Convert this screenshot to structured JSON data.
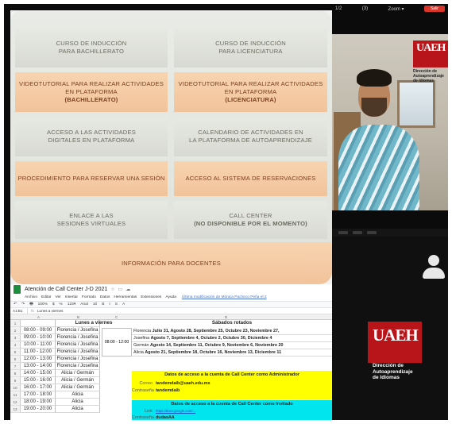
{
  "menu": {
    "tiles": [
      {
        "lines": [
          "Curso de inducción",
          "para Bachillerato"
        ],
        "style": "grey"
      },
      {
        "lines": [
          "Curso de inducción",
          "para Licenciatura"
        ],
        "style": "grey"
      },
      {
        "lines": [
          "Videotutorial para realizar actividades en plataforma"
        ],
        "strong": "(Bachillerato)",
        "style": "peach"
      },
      {
        "lines": [
          "Videotutorial para realizar actividades en plataforma"
        ],
        "strong": "(Licenciatura)",
        "style": "peach"
      },
      {
        "lines": [
          "Acceso a las actividades",
          "digitales en plataforma"
        ],
        "style": "grey"
      },
      {
        "lines": [
          "Calendario de actividades en",
          "la plataforma de autoaprendizaje"
        ],
        "style": "grey"
      },
      {
        "lines": [
          "Procedimiento para reservar una sesión"
        ],
        "style": "peach"
      },
      {
        "lines": [
          "Acceso al Sistema de Reservaciones"
        ],
        "style": "peach"
      },
      {
        "lines": [
          "Enlace a las",
          "Sesiones Virtuales"
        ],
        "style": "grey"
      },
      {
        "lines": [
          "Call Center"
        ],
        "strong": "(NO DISPONIBLE POR EL MOMENTO)",
        "style": "grey"
      },
      {
        "lines": [
          "Información para docentes"
        ],
        "style": "peach"
      }
    ]
  },
  "sheet": {
    "title": "Atención de Call Center J-D 2021",
    "menu": [
      "Archivo",
      "Editar",
      "Ver",
      "Insertar",
      "Formato",
      "Datos",
      "Herramientas",
      "Extensiones",
      "Ayuda"
    ],
    "last_edit": "Última modificación de Mónica Pacheco Peña el 2",
    "toolbar": [
      "↶",
      "↷",
      "🖶",
      "100%",
      "$",
      "%",
      "123▾",
      "Arial",
      "10",
      "B",
      "I",
      "S",
      "A"
    ],
    "cell_ref": "A1:B1",
    "formula": "Lunes a viernes",
    "col_letters": [
      "A",
      "B",
      "C",
      "D"
    ],
    "weekday_header": "Lunes a viernes",
    "saturday_header": "Sábados rotados",
    "rows": [
      {
        "n": "1",
        "time": "",
        "who": ""
      },
      {
        "n": "2",
        "time": "08:00 - 09:00",
        "who": "Florencia / Josefina"
      },
      {
        "n": "3",
        "time": "09:00 - 10:00",
        "who": "Florencia / Josefina"
      },
      {
        "n": "4",
        "time": "10:00 - 11:00",
        "who": "Florencia / Josefina"
      },
      {
        "n": "5",
        "time": "11:00 - 12:00",
        "who": "Florencia / Josefina"
      },
      {
        "n": "6",
        "time": "12:00 - 13:00",
        "who": "Florencia / Josefina"
      },
      {
        "n": "7",
        "time": "13:00 - 14:00",
        "who": "Florencia / Josefina"
      },
      {
        "n": "8",
        "time": "14:00 - 15:00",
        "who": "Alicia / Germán"
      },
      {
        "n": "9",
        "time": "15:00 - 16:00",
        "who": "Alicia / Germán"
      },
      {
        "n": "10",
        "time": "16:00 - 17:00",
        "who": "Alicia / Germán"
      },
      {
        "n": "11",
        "time": "17:00 - 18:00",
        "who": "Alicia"
      },
      {
        "n": "12",
        "time": "18:00 - 19:00",
        "who": "Alicia"
      },
      {
        "n": "13",
        "time": "19:00 - 20:00",
        "who": "Alicia"
      }
    ],
    "saturday_time": "08:00 - 12:00",
    "saturday_rows": [
      {
        "name": "Florencia",
        "dates": "Julio 31, Agosto 28, Septiembre 25, Octubre 23, Noviembre 27,"
      },
      {
        "name": "Josefina",
        "dates": "Agosto 7, Septiembre 4, Octubre 2, Octubre 30, Diciembre 4"
      },
      {
        "name": "Germán",
        "dates": "Agosto 14, Septiembre 11, Octubre 9, Noviembre 6, Noviembre 20"
      },
      {
        "name": "Alicia",
        "dates": "Agosto 21, Septiembre 18, Octubre 16, Noviembre 13, Diciembre 11"
      }
    ],
    "admin_box": {
      "title": "Datos de acceso a la cuenta de Call Center como Administrador",
      "email_label": "Correo",
      "email": "tandemdaib@uaeh.edu.mx",
      "password_label": "Contraseña",
      "password": "tandemdaib"
    },
    "guest_box": {
      "title": "Datos de acceso a la cuenta de Call Center como Invitado",
      "link_label": "Link",
      "link": "https://docs.google.com/...",
      "password_label": "Contraseña",
      "password": "dudasAA"
    }
  },
  "call": {
    "top_labels": [
      "1/2",
      "(3)",
      "Zoom ▾"
    ],
    "leave": "Salir",
    "logo": "UAEH",
    "logo_caption": [
      "Dirección de",
      "Autoaprendizaje",
      "de Idiomas"
    ],
    "guest_logo": "UAEH",
    "guest_caption": [
      "Dirección de",
      "Autoaprendizaje",
      "de Idiomas"
    ],
    "colors": {
      "brand_red": "#b8151b",
      "peach": "#f2c39b",
      "sheet_yellow": "#ffff00",
      "sheet_cyan": "#00e5ee"
    }
  }
}
